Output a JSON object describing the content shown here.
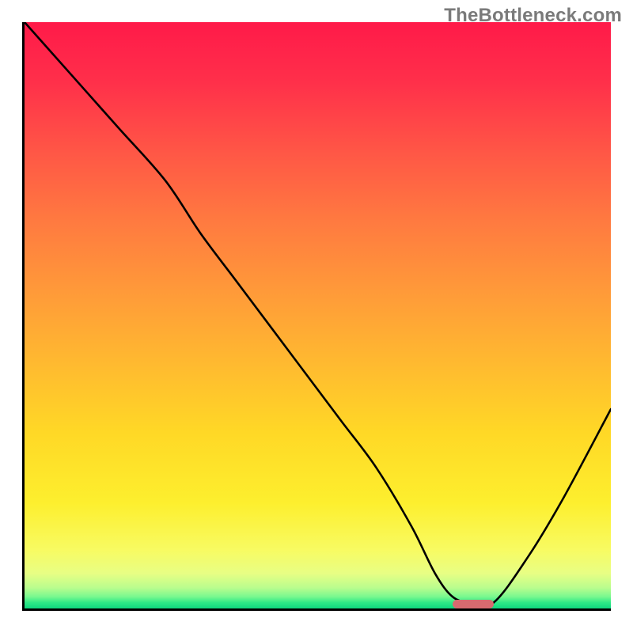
{
  "watermark": "TheBottleneck.com",
  "chart_data": {
    "type": "line",
    "title": "",
    "xlabel": "",
    "ylabel": "",
    "xlim": [
      0,
      100
    ],
    "ylim": [
      0,
      100
    ],
    "grid": false,
    "legend": false,
    "background_gradient": {
      "orientation": "vertical",
      "stops": [
        {
          "pos": 0,
          "color": "#ff1a49"
        },
        {
          "pos": 22,
          "color": "#ff5646"
        },
        {
          "pos": 46,
          "color": "#ff9a39"
        },
        {
          "pos": 70,
          "color": "#ffd826"
        },
        {
          "pos": 90,
          "color": "#f8fb62"
        },
        {
          "pos": 98,
          "color": "#78f88f"
        },
        {
          "pos": 100,
          "color": "#0fd67e"
        }
      ]
    },
    "series": [
      {
        "name": "bottleneck-curve",
        "x": [
          0,
          8,
          16,
          24,
          30,
          36,
          42,
          48,
          54,
          60,
          66,
          70,
          73,
          76,
          80,
          86,
          92,
          100
        ],
        "y": [
          100,
          91,
          82,
          73,
          64,
          56,
          48,
          40,
          32,
          24,
          14,
          6,
          2,
          1,
          1,
          9,
          19,
          34
        ]
      }
    ],
    "annotations": [
      {
        "name": "optimal-range-marker",
        "type": "segment",
        "x0": 73,
        "x1": 80,
        "y": 0.8,
        "color": "#d86a6f"
      }
    ]
  }
}
